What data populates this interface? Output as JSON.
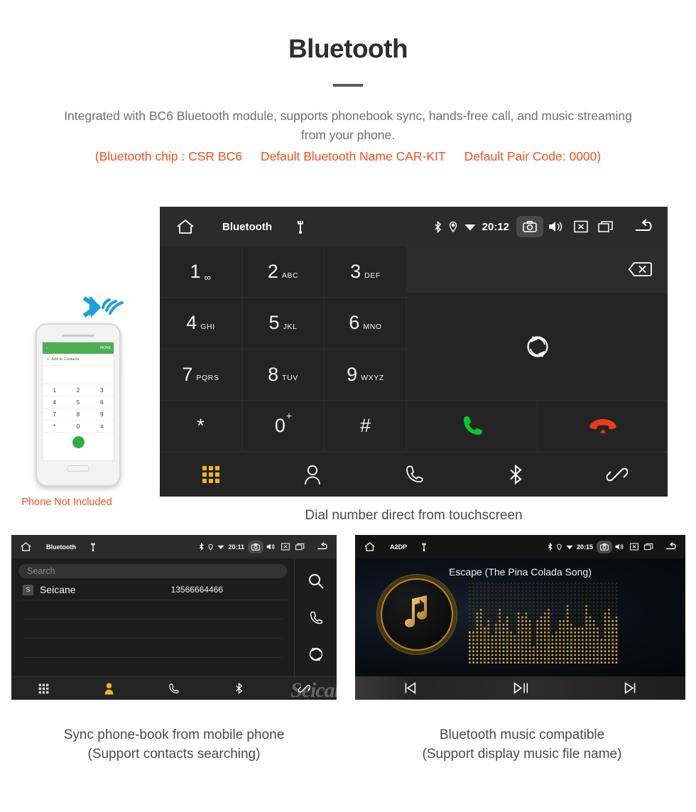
{
  "header": {
    "title": "Bluetooth",
    "intro": "Integrated with BC6 Bluetooth module, supports phonebook sync, hands-free call, and music streaming from your phone.",
    "specs": [
      "(Bluetooth chip : CSR BC6",
      "Default Bluetooth Name CAR-KIT",
      "Default Pair Code: 0000)"
    ]
  },
  "colors": {
    "accent_orange": "#f4511e",
    "key_active": "#f0b323",
    "call_green": "#00c92e",
    "hangup_red": "#ef3b1c",
    "screen_bg": "#242424"
  },
  "dialer": {
    "statusbar": {
      "title": "Bluetooth",
      "time": "20:12",
      "icons": [
        "home-icon",
        "usb-icon",
        "bluetooth-icon",
        "location-icon",
        "wifi-icon",
        "camera-icon",
        "volume-icon",
        "close-box-icon",
        "recent-apps-icon",
        "back-icon"
      ]
    },
    "keys": [
      {
        "digit": "1",
        "letters": "∞",
        "sub": ""
      },
      {
        "digit": "2",
        "letters": "ABC",
        "sub": ""
      },
      {
        "digit": "3",
        "letters": "DEF",
        "sub": ""
      },
      {
        "digit": "4",
        "letters": "GHI",
        "sub": ""
      },
      {
        "digit": "5",
        "letters": "JKL",
        "sub": ""
      },
      {
        "digit": "6",
        "letters": "MNO",
        "sub": ""
      },
      {
        "digit": "7",
        "letters": "PQRS",
        "sub": ""
      },
      {
        "digit": "8",
        "letters": "TUV",
        "sub": ""
      },
      {
        "digit": "9",
        "letters": "WXYZ",
        "sub": ""
      },
      {
        "digit": "*",
        "letters": "",
        "sub": ""
      },
      {
        "digit": "0",
        "letters": "",
        "sub": "+"
      },
      {
        "digit": "#",
        "letters": "",
        "sub": ""
      }
    ],
    "number_value": "",
    "tabs": [
      "keypad-tab",
      "contacts-tab",
      "call-history-tab",
      "bluetooth-tab",
      "pair-link-tab"
    ],
    "active_tab": "keypad-tab",
    "caption": "Dial number direct from touchscreen"
  },
  "phonebook": {
    "statusbar": {
      "title": "Bluetooth",
      "time": "20:11"
    },
    "search_placeholder": "Search",
    "contacts": [
      {
        "initial": "S",
        "name": "Seicane",
        "number": "13566664466"
      }
    ],
    "side_icons": [
      "search-icon",
      "call-icon",
      "sync-icon"
    ],
    "tabs": [
      "keypad-tab",
      "contacts-tab",
      "call-history-tab",
      "bluetooth-tab",
      "pair-link-tab"
    ],
    "active_tab": "contacts-tab",
    "watermark": "Seicane",
    "caption_line1": "Sync phone-book from mobile phone",
    "caption_line2": "(Support contacts searching)"
  },
  "music": {
    "statusbar": {
      "title": "A2DP",
      "time": "20:15"
    },
    "song_title": "Escape (The Pina Colada Song)",
    "controls": [
      "previous-track-button",
      "play-pause-button",
      "next-track-button"
    ],
    "caption_line1": "Bluetooth music compatible",
    "caption_line2": "(Support display music file name)"
  },
  "phone_mockup": {
    "top_bar_action": "MORE",
    "add_to_contacts": "Add to Contacts",
    "keys": [
      "1",
      "2",
      "3",
      "4",
      "5",
      "6",
      "7",
      "8",
      "9",
      "*",
      "0",
      "#"
    ],
    "note": "Phone Not Included"
  }
}
